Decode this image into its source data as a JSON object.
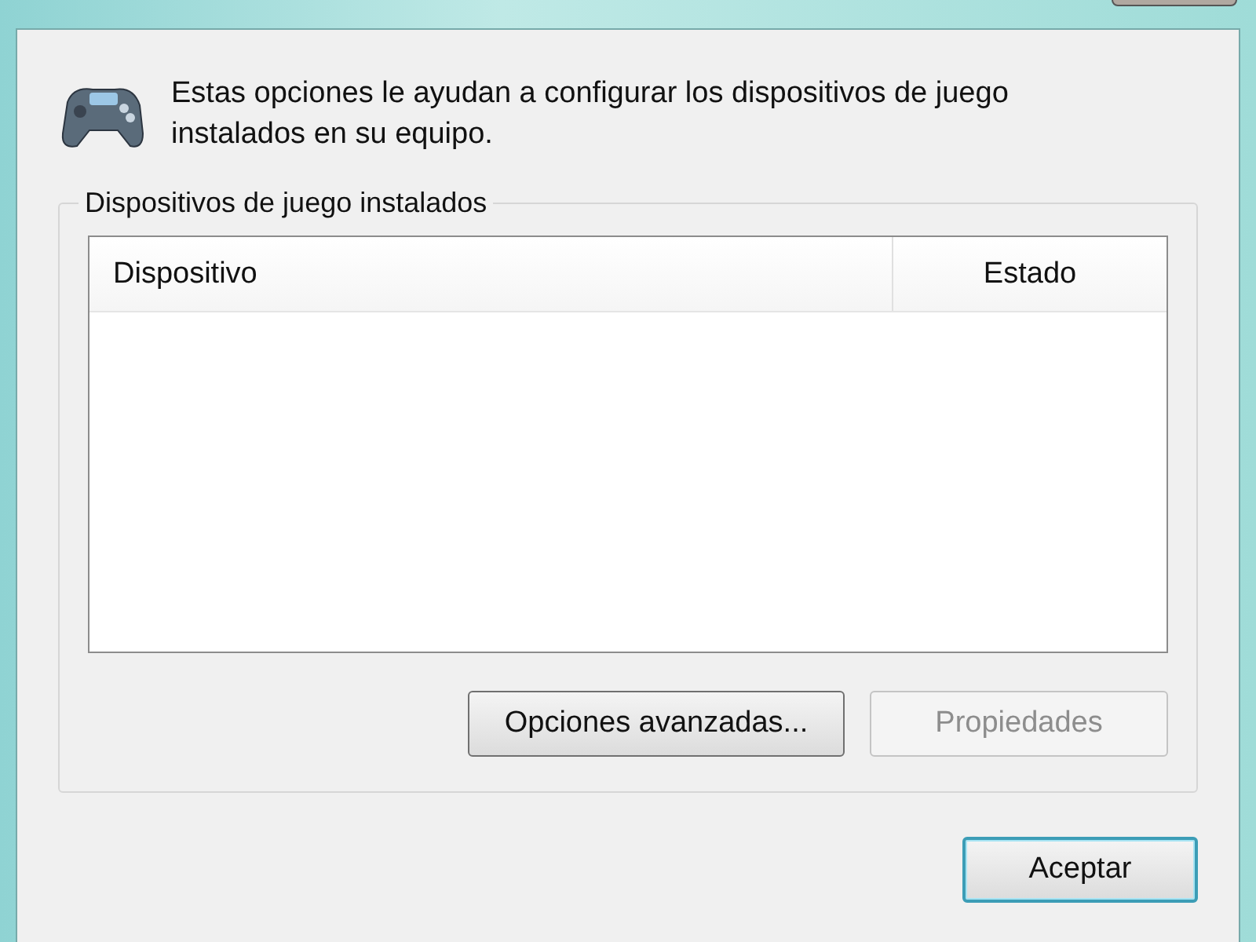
{
  "intro": "Estas opciones le ayudan a configurar los dispositivos de juego instalados en su equipo.",
  "group": {
    "title": "Dispositivos de juego instalados",
    "columns": [
      "Dispositivo",
      "Estado"
    ],
    "buttons": [
      {
        "label": "Opciones avanzadas...",
        "disabled": false
      },
      {
        "label": "Propiedades",
        "disabled": true
      }
    ]
  },
  "footer_buttons": [
    {
      "label": "Aceptar",
      "default": true
    }
  ]
}
